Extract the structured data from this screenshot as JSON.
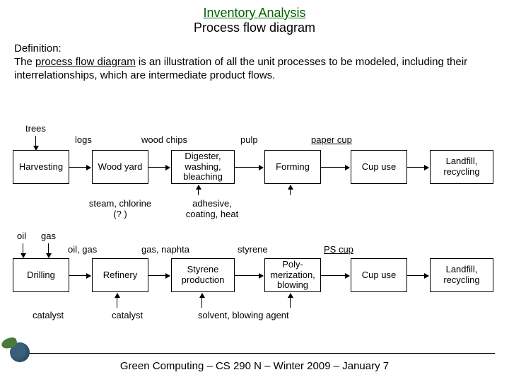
{
  "title": {
    "line1": "Inventory Analysis",
    "line2": "Process flow diagram"
  },
  "definition": {
    "lead": "Definition:",
    "the": "The ",
    "term": "process flow diagram",
    "rest": " is an illustration of all the unit processes to be modeled, including their interrelationships, which are intermediate product flows."
  },
  "row1": {
    "input_top": "trees",
    "boxes": [
      "Harvesting",
      "Wood yard",
      "Digester, washing, bleaching",
      "Forming",
      "Cup use",
      "Landfill, recycling"
    ],
    "flow_labels": [
      "logs",
      "wood chips",
      "pulp",
      "paper cup"
    ],
    "aux_inputs": [
      "steam, chlorine (? )",
      "adhesive, coating, heat"
    ]
  },
  "row2": {
    "input_top1": "oil",
    "input_top2": "gas",
    "boxes": [
      "Drilling",
      "Refinery",
      "Styrene production",
      "Poly-merization, blowing",
      "Cup use",
      "Landfill, recycling"
    ],
    "flow_labels": [
      "oil, gas",
      "gas, naphta",
      "styrene",
      "PS cup"
    ],
    "aux_inputs": [
      "catalyst",
      "catalyst",
      "solvent, blowing agent"
    ]
  },
  "footer": "Green Computing – CS 290 N – Winter 2009 – January 7"
}
